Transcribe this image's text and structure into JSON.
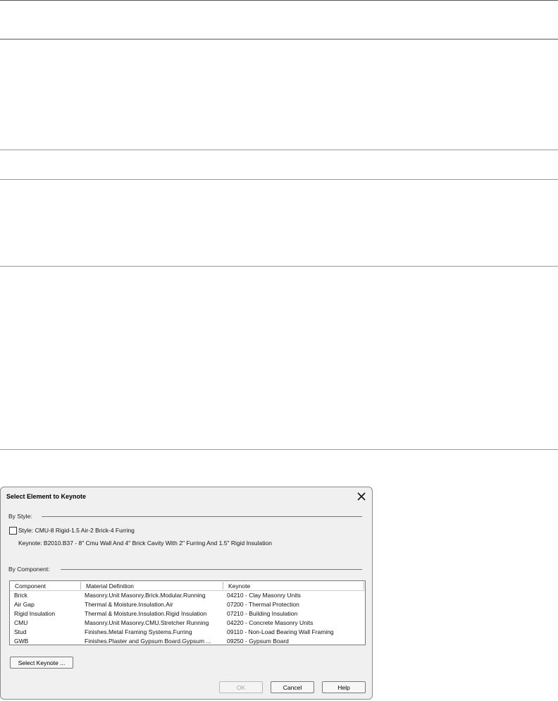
{
  "dialog": {
    "title": "Select Element to Keynote",
    "by_style_label": "By Style:",
    "style_checkbox_label": "Style: CMU-8 Rigid-1.5 Air-2 Brick-4 Furring",
    "style_checked": false,
    "keynote_text": "Keynote: B2010.B37 - 8\" Cmu Wall And 4\" Brick Cavity With 2\" Furring And 1.5\" Rigid Insulation",
    "by_component_label": "By Component:",
    "table": {
      "headers": [
        "Component",
        "Material Definition",
        "Keynote"
      ],
      "rows": [
        [
          "Brick",
          "Masonry.Unit Masonry.Brick.Modular.Running",
          "04210 - Clay Masonry Units"
        ],
        [
          "Air Gap",
          "Thermal & Moisture.Insulation.Air",
          "07200 - Thermal Protection"
        ],
        [
          "Rigid Insulation",
          "Thermal & Moisture.Insulation.Rigid Insulation",
          "07210 - Building Insulation"
        ],
        [
          "CMU",
          "Masonry.Unit Masonry.CMU.Stretcher Running",
          "04220 - Concrete Masonry Units"
        ],
        [
          "Stud",
          "Finishes.Metal Framing Systems.Furring",
          "09110 - Non-Load Bearing Wall Framing"
        ],
        [
          "GWB",
          "Finishes.Plaster and Gypsum Board.Gypsum ...",
          "09250 - Gypsum Board"
        ]
      ]
    },
    "buttons": {
      "select_keynote": "Select Keynote ...",
      "ok": "OK",
      "cancel": "Cancel",
      "help": "Help"
    },
    "icons": {
      "close": "close-icon"
    }
  }
}
